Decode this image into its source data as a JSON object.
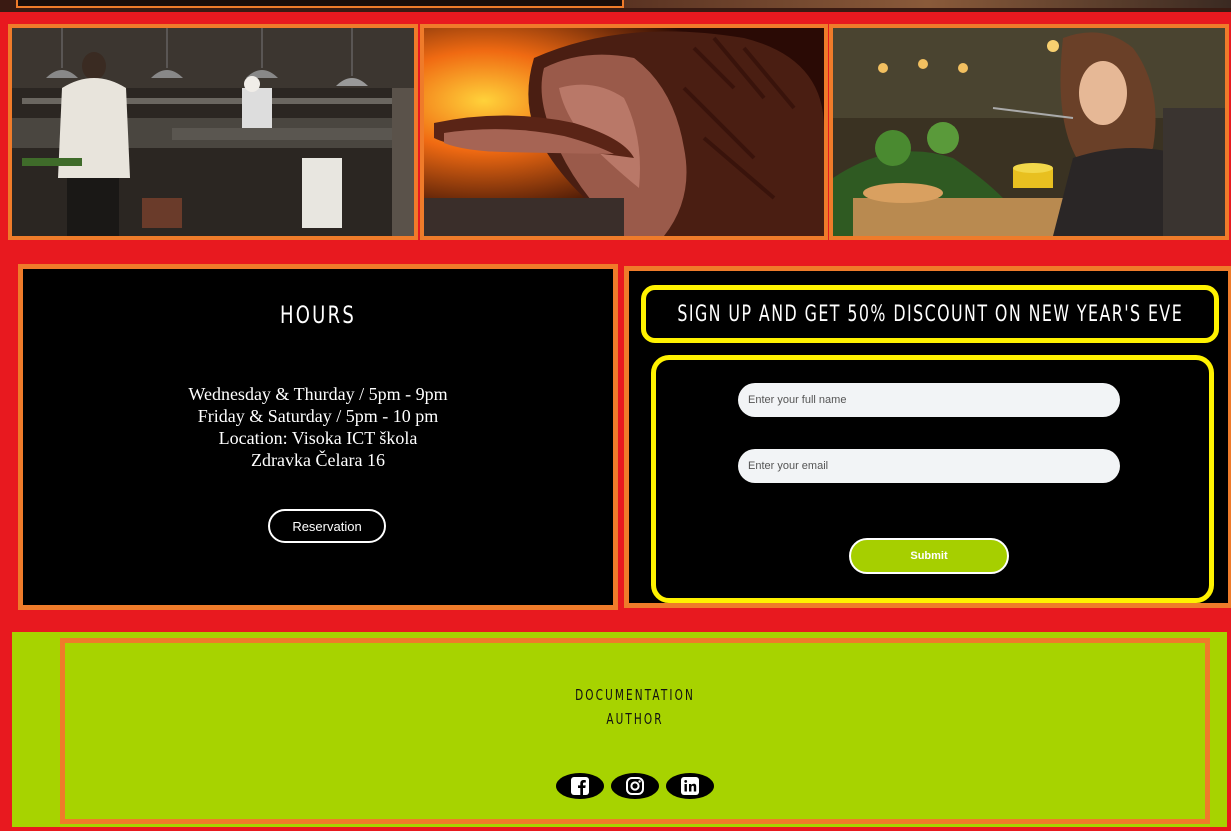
{
  "hours": {
    "title": "HOURS",
    "lines": [
      "Wednesday & Thurday / 5pm - 9pm",
      "Friday & Saturday / 5pm - 10 pm",
      "Location: Visoka ICT škola",
      "Zdravka Čelara 16"
    ],
    "reservation_label": "Reservation"
  },
  "signup": {
    "title": "SIGN UP AND GET 50% DISCOUNT ON NEW YEAR'S EVE",
    "name_placeholder": "Enter your full name",
    "email_placeholder": "Enter your email",
    "submit_label": "Submit"
  },
  "footer": {
    "links": [
      "DOCUMENTATION",
      "AUTHOR"
    ],
    "social_icons": [
      "facebook-icon",
      "instagram-icon",
      "linkedin-icon"
    ]
  },
  "colors": {
    "accent_red": "#e8191f",
    "frame_orange": "#ef7b2a",
    "highlight_yellow": "#fff200",
    "lime": "#a7d300"
  },
  "images": [
    "chef kitchen photo",
    "roast beef photo",
    "woman dining photo"
  ]
}
